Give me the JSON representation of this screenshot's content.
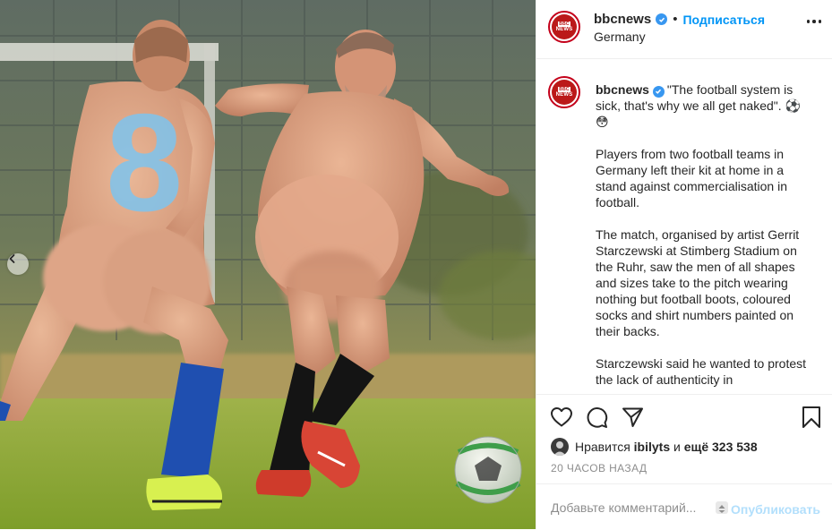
{
  "header": {
    "username": "bbcnews",
    "separator": "•",
    "follow_label": "Подписаться",
    "location": "Germany",
    "avatar_line1": "BBC",
    "avatar_line2": "NEWS"
  },
  "caption": {
    "username": "bbcnews",
    "text": "\"The football system is sick, that's why we all get naked\". ⚽😳\n\nPlayers from two football teams in Germany left their kit at home in a stand against commercialisation in football.\n\nThe match, organised by artist Gerrit Starczewski at Stimberg Stadium on the Ruhr, saw the men of all shapes and sizes take to the pitch wearing nothing but football boots, coloured socks and shirt numbers painted on their backs.\n\nStarczewski said he wanted to protest the lack of authenticity in"
  },
  "photo": {
    "shirt_number": "8"
  },
  "likes": {
    "prefix": "Нравится",
    "user": "ibilyts",
    "connector": "и",
    "others": "ещё 323 538"
  },
  "timestamp": "20 ЧАСОВ НАЗАД",
  "comment": {
    "placeholder": "Добавьте комментарий...",
    "publish_label": "Опубликовать"
  },
  "icons": {
    "like": "heart-icon",
    "comment": "comment-icon",
    "share": "paper-plane-icon",
    "save": "bookmark-icon",
    "more": "more-options-icon",
    "prev": "chevron-left-icon",
    "emoji": "emoji-icon",
    "verified": "verified-badge-icon"
  },
  "colors": {
    "link": "#0095f6",
    "publish_disabled": "#b2dffc",
    "muted": "#8e8e8e",
    "brand_red": "#bb1919",
    "verified": "#3897f0"
  }
}
